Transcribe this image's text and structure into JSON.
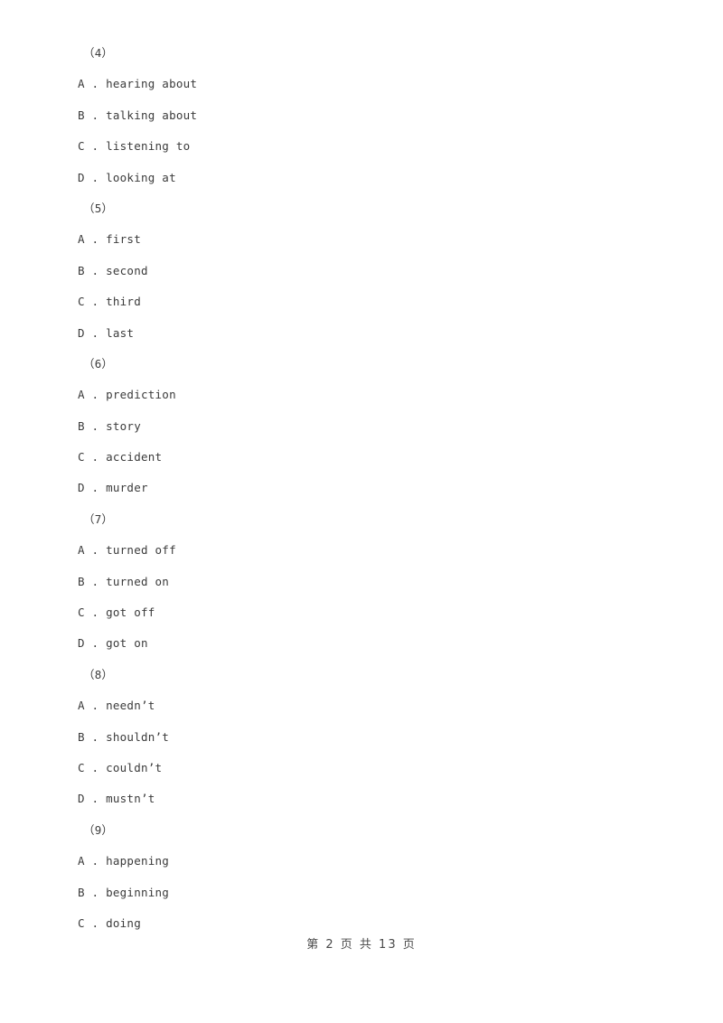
{
  "document": {
    "page_background": "#ffffff",
    "text_color": "#3b3b3b",
    "footer_color": "#4a4a4a"
  },
  "questions": [
    {
      "number": "（4）",
      "options": [
        "A . hearing about",
        "B . talking about",
        "C . listening to",
        "D . looking at"
      ]
    },
    {
      "number": "（5）",
      "options": [
        "A . first",
        "B . second",
        "C . third",
        "D . last"
      ]
    },
    {
      "number": "（6）",
      "options": [
        "A . prediction",
        "B . story",
        "C . accident",
        "D . murder"
      ]
    },
    {
      "number": "（7）",
      "options": [
        "A . turned off",
        "B . turned on",
        "C . got off",
        "D . got on"
      ]
    },
    {
      "number": "（8）",
      "options": [
        "A . needn’t",
        "B . shouldn’t",
        "C . couldn’t",
        "D . mustn’t"
      ]
    },
    {
      "number": "（9）",
      "options": [
        "A . happening",
        "B . beginning",
        "C . doing"
      ]
    }
  ],
  "footer": {
    "page_label": "第 2 页 共 13 页",
    "current_page": "2",
    "total_pages": "13"
  }
}
